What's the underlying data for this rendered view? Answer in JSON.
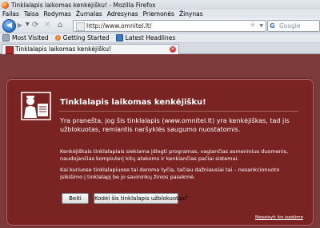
{
  "window": {
    "title": "Tinklalapis laikomas kenkėjišku! - Mozilla Firefox"
  },
  "menu": [
    "Failas",
    "Taisa",
    "Rodymas",
    "Žurnalas",
    "Adresynas",
    "Priemonės",
    "Žinynas"
  ],
  "navigation": {
    "url": "http://www.omnitel.lt/",
    "search_placeholder": "Google"
  },
  "bookmarks": [
    {
      "label": "Most Visited",
      "icon": "most-visited-icon"
    },
    {
      "label": "Getting Started",
      "icon": "getting-started-icon"
    },
    {
      "label": "Latest Headlines",
      "icon": "rss-icon"
    }
  ],
  "tab": {
    "label": "Tinklalapis laikomas kenkėjišku!"
  },
  "error": {
    "title": "Tinklalapis laikomas kenkėjišku!",
    "message": "Yra pranešta, jog šis tinklalapis (www.omnitel.lt) yra kenkėjiškas, tad jis užblokuotas, remiantis naršyklės saugumo nuostatomis.",
    "paragraph1": "Kenkėjiškais tinklalapiais siekiama įdiegti programas, vagiančias asmeninius duomenis, naudojančias kompiuterį kitų atakoms ir kenkiančias pačiai sistemai.",
    "paragraph2": "Kai kuriuose tinklalapiuose tai daroma tyčia, tačiau dažniausiai tai – nesankcionuoto įsikišimo į tinklalapį be jo savininkų žinios pasekmė.",
    "button_back": "Beiti",
    "button_why": "Kodėl šis tinklalapis užblokuotas?",
    "ignore_link": "Nepaisyti šio įspėjimo"
  },
  "colors": {
    "panel": "#7a2323",
    "background": "#7d3a3a",
    "accent": "#2a6fc9"
  }
}
